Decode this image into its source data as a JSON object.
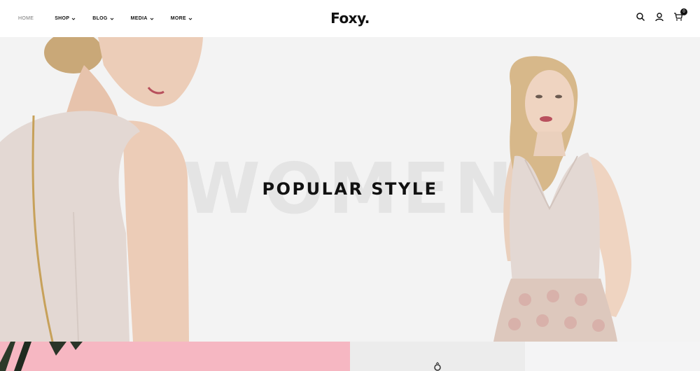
{
  "nav": {
    "home": "HOME",
    "shop": "SHOP",
    "blog": "BLOG",
    "media": "MEDIA",
    "more": "MORE"
  },
  "logo": "Foxy.",
  "cart": {
    "count": "0"
  },
  "hero": {
    "watermark": "WOMEN",
    "title": "POPULAR STYLE"
  },
  "icons": {
    "search": "search-icon",
    "account": "user-icon",
    "cart": "cart-icon"
  },
  "colors": {
    "hero_bg": "#f3f3f3",
    "watermark": "#e4e4e4",
    "dress": "#e3d8d3",
    "skin": "#eccdb8",
    "hair": "#d7b88a",
    "pink_tile": "#f6b7c2"
  }
}
